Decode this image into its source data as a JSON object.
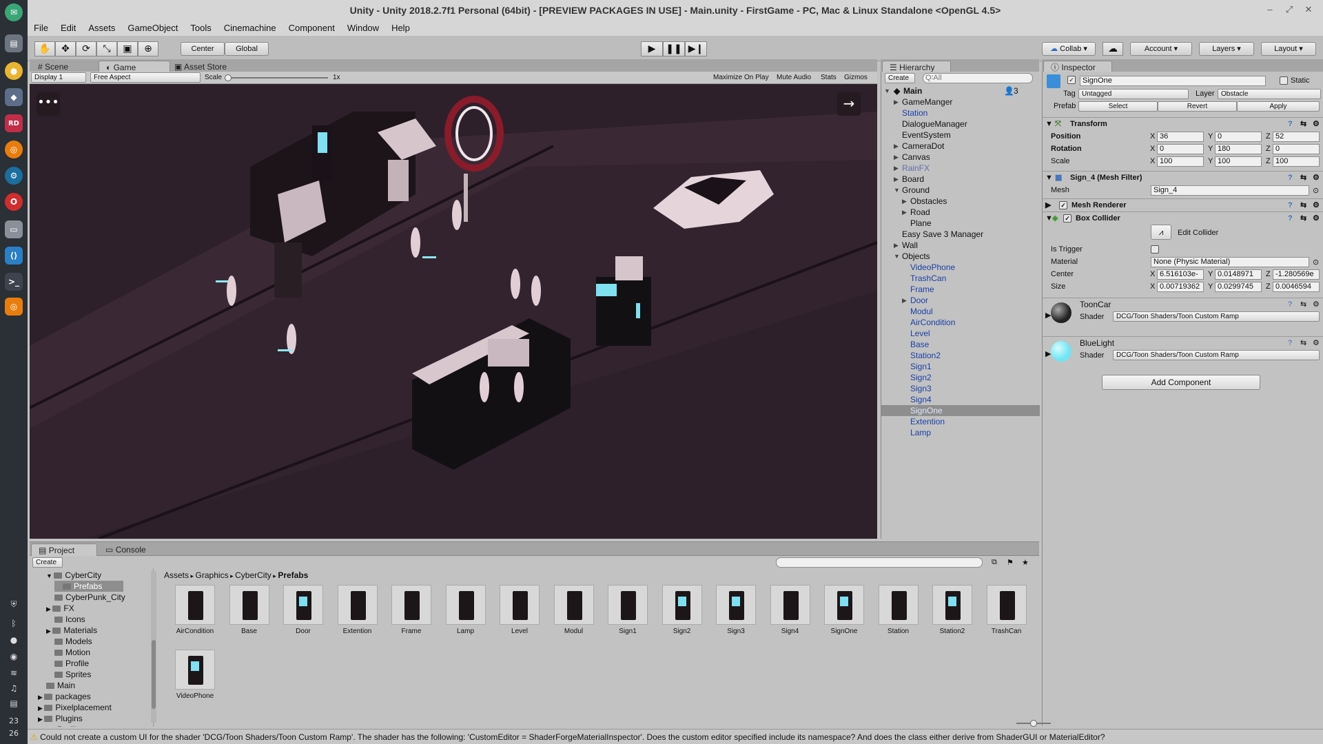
{
  "title": "Unity - Unity 2018.2.7f1 Personal (64bit) - [PREVIEW PACKAGES IN USE] - Main.unity - FirstGame - PC, Mac & Linux Standalone <OpenGL 4.5>",
  "menu": [
    "File",
    "Edit",
    "Assets",
    "GameObject",
    "Tools",
    "Cinemachine",
    "Component",
    "Window",
    "Help"
  ],
  "toolbar": {
    "center": "Center",
    "global": "Global",
    "collab": "Collab",
    "account": "Account",
    "layers": "Layers",
    "layout": "Layout"
  },
  "tabs": {
    "scene": "Scene",
    "game": "Game",
    "asset_store": "Asset Store",
    "hierarchy": "Hierarchy",
    "inspector": "Inspector",
    "project": "Project",
    "console": "Console"
  },
  "gamebar": {
    "display": "Display 1",
    "aspect": "Free Aspect",
    "scale_label": "Scale",
    "scale_value": "1x",
    "maximize": "Maximize On Play",
    "mute": "Mute Audio",
    "stats": "Stats",
    "gizmos": "Gizmos"
  },
  "hierarchy": {
    "create": "Create",
    "search_placeholder": "Q∶All",
    "scene": "Main",
    "badge": "3",
    "items": [
      {
        "label": "GameManger",
        "indent": 1,
        "arrow": "▶",
        "style": ""
      },
      {
        "label": "Station",
        "indent": 1,
        "arrow": "",
        "style": "prefab"
      },
      {
        "label": "DialogueManager",
        "indent": 1,
        "arrow": "",
        "style": ""
      },
      {
        "label": "EventSystem",
        "indent": 1,
        "arrow": "",
        "style": ""
      },
      {
        "label": "CameraDot",
        "indent": 1,
        "arrow": "▶",
        "style": ""
      },
      {
        "label": "Canvas",
        "indent": 1,
        "arrow": "▶",
        "style": ""
      },
      {
        "label": "RainFX",
        "indent": 1,
        "arrow": "▶",
        "style": "dim"
      },
      {
        "label": "Board",
        "indent": 1,
        "arrow": "▶",
        "style": ""
      },
      {
        "label": "Ground",
        "indent": 1,
        "arrow": "▼",
        "style": ""
      },
      {
        "label": "Obstacles",
        "indent": 2,
        "arrow": "▶",
        "style": ""
      },
      {
        "label": "Road",
        "indent": 2,
        "arrow": "▶",
        "style": ""
      },
      {
        "label": "Plane",
        "indent": 2,
        "arrow": "",
        "style": ""
      },
      {
        "label": "Easy Save 3 Manager",
        "indent": 1,
        "arrow": "",
        "style": ""
      },
      {
        "label": "Wall",
        "indent": 1,
        "arrow": "▶",
        "style": ""
      },
      {
        "label": "Objects",
        "indent": 1,
        "arrow": "▼",
        "style": ""
      },
      {
        "label": "VideoPhone",
        "indent": 2,
        "arrow": "",
        "style": "prefab"
      },
      {
        "label": "TrashCan",
        "indent": 2,
        "arrow": "",
        "style": "prefab"
      },
      {
        "label": "Frame",
        "indent": 2,
        "arrow": "",
        "style": "prefab"
      },
      {
        "label": "Door",
        "indent": 2,
        "arrow": "▶",
        "style": "prefab"
      },
      {
        "label": "Modul",
        "indent": 2,
        "arrow": "",
        "style": "prefab"
      },
      {
        "label": "AirCondition",
        "indent": 2,
        "arrow": "",
        "style": "prefab"
      },
      {
        "label": "Level",
        "indent": 2,
        "arrow": "",
        "style": "prefab"
      },
      {
        "label": "Base",
        "indent": 2,
        "arrow": "",
        "style": "prefab"
      },
      {
        "label": "Station2",
        "indent": 2,
        "arrow": "",
        "style": "prefab"
      },
      {
        "label": "Sign1",
        "indent": 2,
        "arrow": "",
        "style": "prefab"
      },
      {
        "label": "Sign2",
        "indent": 2,
        "arrow": "",
        "style": "prefab"
      },
      {
        "label": "Sign3",
        "indent": 2,
        "arrow": "",
        "style": "prefab"
      },
      {
        "label": "Sign4",
        "indent": 2,
        "arrow": "",
        "style": "prefab"
      },
      {
        "label": "SignOne",
        "indent": 2,
        "arrow": "",
        "style": "sel"
      },
      {
        "label": "Extention",
        "indent": 2,
        "arrow": "",
        "style": "prefab"
      },
      {
        "label": "Lamp",
        "indent": 2,
        "arrow": "",
        "style": "prefab"
      }
    ]
  },
  "inspector": {
    "name": "SignOne",
    "static": "Static",
    "tag_label": "Tag",
    "tag": "Untagged",
    "layer_label": "Layer",
    "layer": "Obstacle",
    "prefab_label": "Prefab",
    "select": "Select",
    "revert": "Revert",
    "apply": "Apply",
    "transform": "Transform",
    "position": "Position",
    "rotation": "Rotation",
    "scale": "Scale",
    "pos": [
      "36",
      "0",
      "52"
    ],
    "rot": [
      "0",
      "180",
      "0"
    ],
    "scl": [
      "100",
      "100",
      "100"
    ],
    "meshfilter": "Sign_4 (Mesh Filter)",
    "mesh_label": "Mesh",
    "mesh": "Sign_4",
    "renderer": "Mesh Renderer",
    "collider": "Box Collider",
    "edit_collider": "Edit Collider",
    "is_trigger": "Is Trigger",
    "material_label": "Material",
    "material": "None (Physic Material)",
    "center_label": "Center",
    "center": [
      "6.516103e-",
      "0.0148971",
      "-1.280569e"
    ],
    "size_label": "Size",
    "size": [
      "0.00719362",
      "0.0299745",
      "0.0046594"
    ],
    "mat1": "ToonCar",
    "mat2": "BlueLight",
    "shader_label": "Shader",
    "shader": "DCG/Toon Shaders/Toon Custom Ramp",
    "add_component": "Add Component"
  },
  "project": {
    "create": "Create",
    "breadcrumb": [
      "Assets",
      "Graphics",
      "CyberCity",
      "Prefabs"
    ],
    "tree": [
      {
        "label": "CyberCity",
        "indent": 2,
        "arrow": "▼"
      },
      {
        "label": "Prefabs",
        "indent": 3,
        "arrow": "",
        "sel": true
      },
      {
        "label": "CyberPunk_City",
        "indent": 2,
        "arrow": ""
      },
      {
        "label": "FX",
        "indent": 2,
        "arrow": "▶"
      },
      {
        "label": "Icons",
        "indent": 2,
        "arrow": ""
      },
      {
        "label": "Materials",
        "indent": 2,
        "arrow": "▶"
      },
      {
        "label": "Models",
        "indent": 2,
        "arrow": ""
      },
      {
        "label": "Motion",
        "indent": 2,
        "arrow": ""
      },
      {
        "label": "Profile",
        "indent": 2,
        "arrow": ""
      },
      {
        "label": "Sprites",
        "indent": 2,
        "arrow": ""
      },
      {
        "label": "Main",
        "indent": 1,
        "arrow": ""
      },
      {
        "label": "packages",
        "indent": 1,
        "arrow": "▶"
      },
      {
        "label": "Pixelplacement",
        "indent": 1,
        "arrow": "▶"
      },
      {
        "label": "Plugins",
        "indent": 1,
        "arrow": "▶"
      },
      {
        "label": "Profile",
        "indent": 1,
        "arrow": ""
      }
    ],
    "assets": [
      "AirCondition",
      "Base",
      "Door",
      "Extention",
      "Frame",
      "Lamp",
      "Level",
      "Modul",
      "Sign1",
      "Sign2",
      "Sign3",
      "Sign4",
      "SignOne",
      "Station",
      "Station2",
      "TrashCan",
      "VideoPhone"
    ]
  },
  "status": "Could not create a custom UI for the shader 'DCG/Toon Shaders/Toon Custom Ramp'. The shader has the following: 'CustomEditor = ShaderForgeMaterialInspector'. Does the custom editor specified include its namespace? And does the class either derive from ShaderGUI or MaterialEditor?",
  "dock": {
    "time_h": "23",
    "time_m": "26"
  }
}
